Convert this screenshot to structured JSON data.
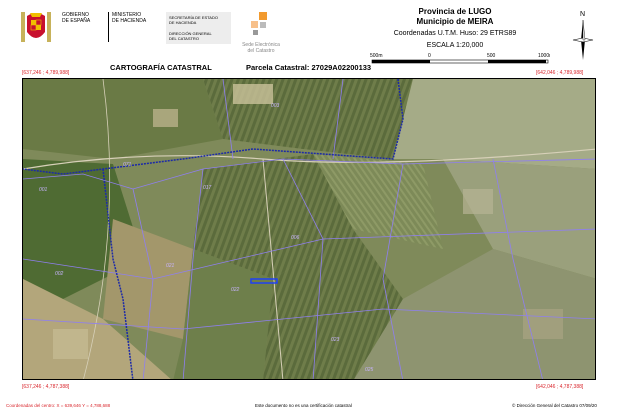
{
  "header": {
    "gov_lines": [
      "GOBIERNO",
      "DE ESPAÑA"
    ],
    "ministry_lines": [
      "MINISTERIO",
      "DE HACIENDA"
    ],
    "secretaria_lines": [
      "SECRETARÍA DE ESTADO",
      "DE HACIENDA"
    ],
    "direccion_lines": [
      "DIRECCIÓN GENERAL",
      "DEL CATASTRO"
    ],
    "sede_lines": [
      "Sede Electrónica",
      "del Catastro"
    ],
    "province": "Provincia de LUGO",
    "municipio": "Municipio de MEIRA",
    "coords": "Coordenadas U.T.M. Huso: 29 ETRS89",
    "scale": "ESCALA 1:20,000",
    "scalebar_labels": [
      "500m",
      "0",
      "500",
      "1000m"
    ],
    "north_label": "N"
  },
  "title": {
    "left": "CARTOGRAFÍA CATASTRAL",
    "right": "Parcela Catastral: 27029A02200133"
  },
  "corners": {
    "top_left": "[637,246 ; 4,789,988]",
    "top_right": "[642,046 ; 4,789,988]",
    "bottom_left": "[637,246 ; 4,787,388]",
    "bottom_right": "[642,046 ; 4,787,388]"
  },
  "map": {
    "parcel_labels": [
      "003",
      "071",
      "017",
      "001",
      "021",
      "022",
      "002",
      "023",
      "006",
      "025"
    ],
    "colors": {
      "boundary": "#8f7ff0",
      "municipal_line": "#1c2aa8",
      "highlight": "#1a3cff"
    }
  },
  "footer": {
    "left": "Coordenadas del centro: X = 639,646 Y = 4,788,688",
    "middle": "Este documento no es una certificación catastral",
    "right": "© Dirección General del Catastro 07/09/20"
  }
}
